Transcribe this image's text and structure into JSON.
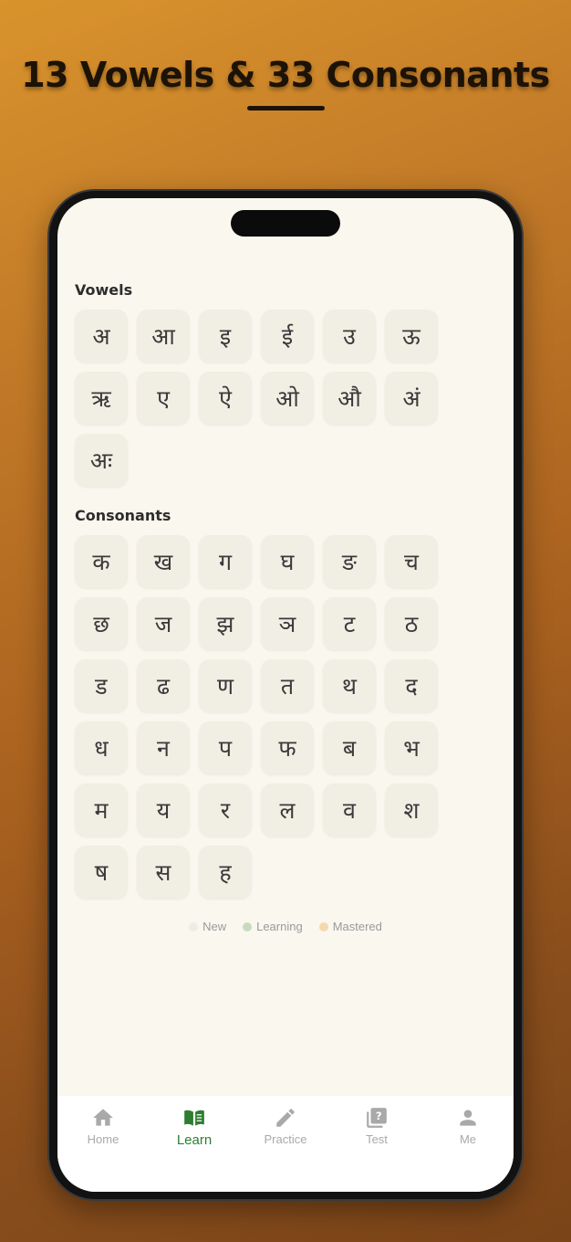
{
  "headline": "13 Vowels & 33 Consonants",
  "vowels": {
    "title": "Vowels",
    "letters": [
      "अ",
      "आ",
      "इ",
      "ई",
      "उ",
      "ऊ",
      "ऋ",
      "ए",
      "ऐ",
      "ओ",
      "औ",
      "अं",
      "अः"
    ]
  },
  "consonants": {
    "title": "Consonants",
    "letters": [
      "क",
      "ख",
      "ग",
      "घ",
      "ङ",
      "च",
      "छ",
      "ज",
      "झ",
      "ञ",
      "ट",
      "ठ",
      "ड",
      "ढ",
      "ण",
      "त",
      "थ",
      "द",
      "ध",
      "न",
      "प",
      "फ",
      "ब",
      "भ",
      "म",
      "य",
      "र",
      "ल",
      "व",
      "श",
      "ष",
      "स",
      "ह"
    ]
  },
  "legend": [
    {
      "label": "New",
      "color": "#efece3"
    },
    {
      "label": "Learning",
      "color": "#c6dcc0"
    },
    {
      "label": "Mastered",
      "color": "#f6d8ad"
    }
  ],
  "nav": [
    {
      "label": "Home",
      "icon": "home-icon",
      "active": false
    },
    {
      "label": "Learn",
      "icon": "book-icon",
      "active": true
    },
    {
      "label": "Practice",
      "icon": "pencil-icon",
      "active": false
    },
    {
      "label": "Test",
      "icon": "quiz-icon",
      "active": false
    },
    {
      "label": "Me",
      "icon": "person-icon",
      "active": false
    }
  ],
  "colors": {
    "accent": "#2e7d32",
    "tile": "#f1eee4",
    "background": "#faf7ee"
  }
}
